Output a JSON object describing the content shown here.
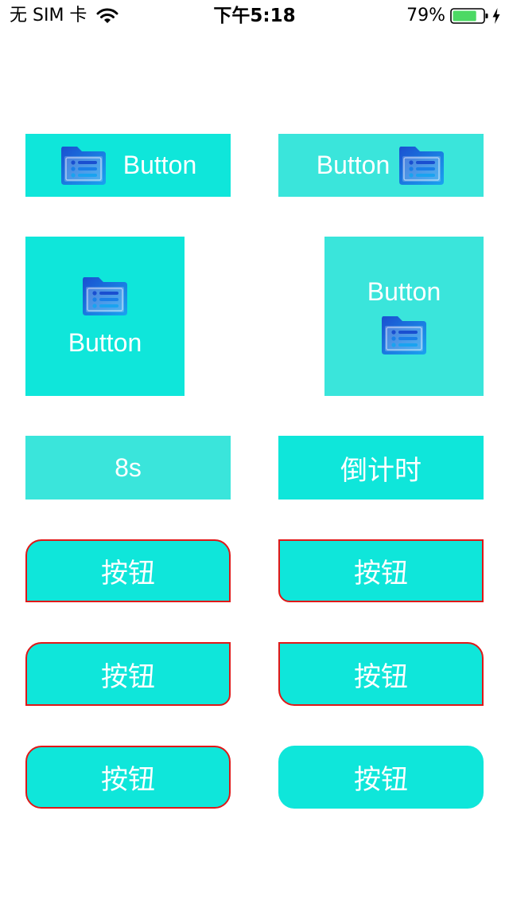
{
  "status_bar": {
    "carrier": "无 SIM 卡",
    "time": "下午5:18",
    "battery_percent": "79%",
    "battery_level": 0.79,
    "wifi_icon": "wifi-icon",
    "battery_icon": "battery-icon",
    "charging_icon": "charging-bolt-icon"
  },
  "buttons": {
    "icon_left_label": "Button",
    "icon_right_label": "Button",
    "icon_top_label": "Button",
    "icon_bottom_label": "Button",
    "countdown_running_label": "8s",
    "countdown_label": "倒计时",
    "corner_buttons": [
      "按钮",
      "按钮",
      "按钮",
      "按钮",
      "按钮",
      "按钮"
    ],
    "icon_name": "folder-list-icon"
  },
  "colors": {
    "button_teal": "#0fe6da",
    "button_teal_alt": "#3ae5db",
    "border_red": "#e01818",
    "text_white": "#ffffff"
  }
}
